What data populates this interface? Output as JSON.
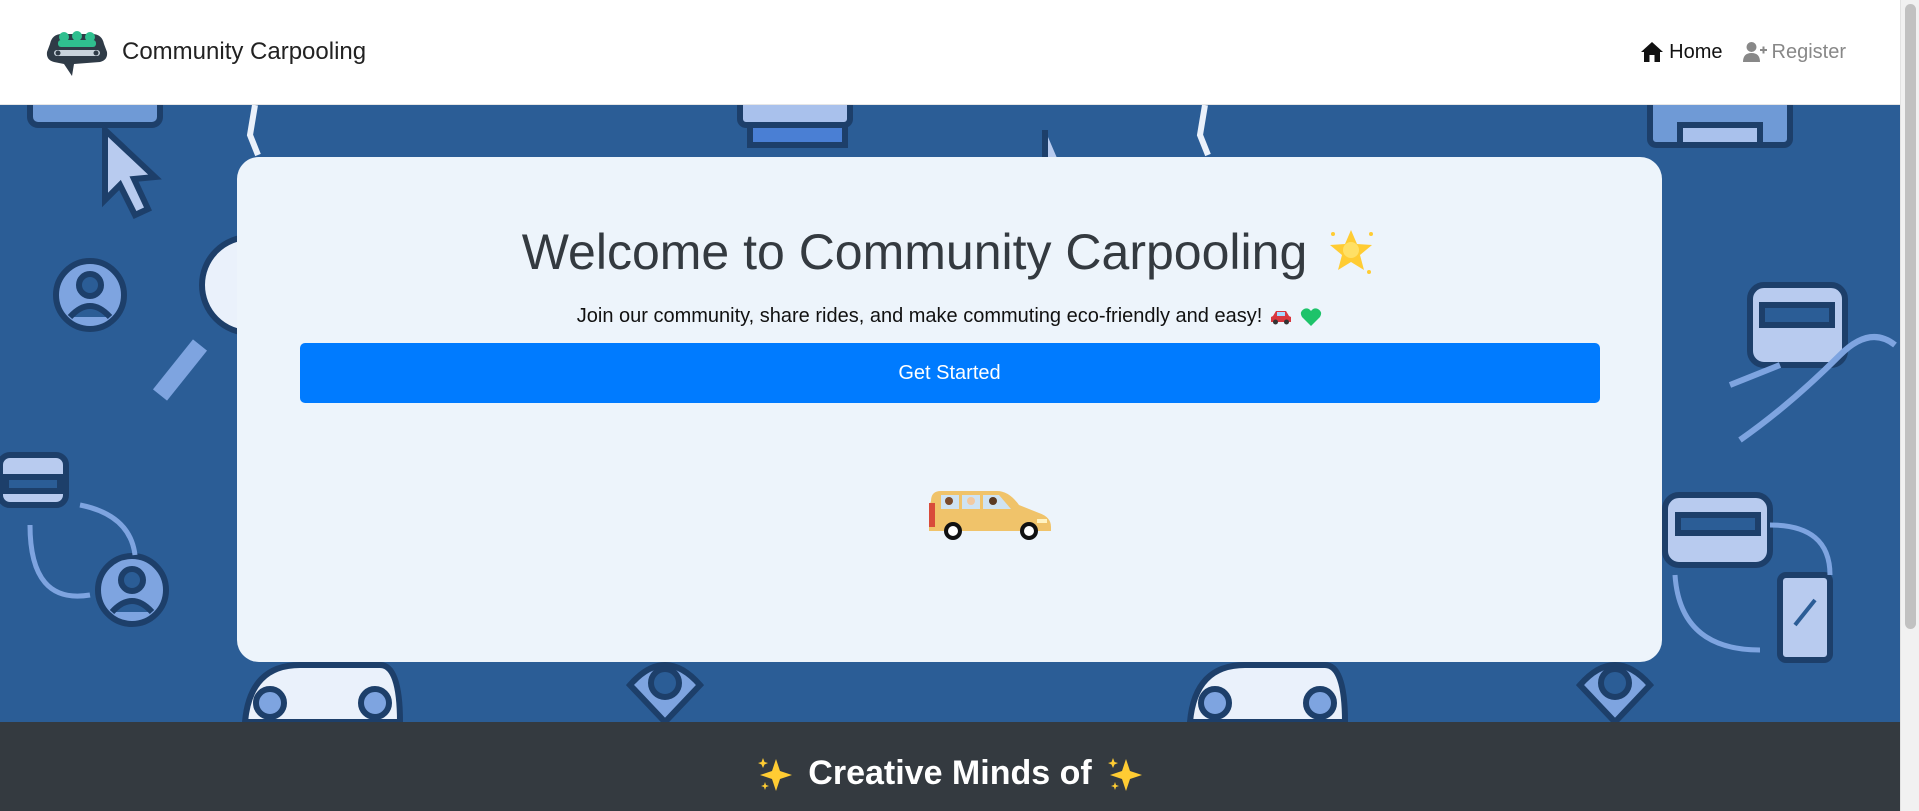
{
  "navbar": {
    "brand_text": "Community Carpooling",
    "logo_icon": "carpool-logo-icon",
    "links": [
      {
        "label": "Home",
        "icon": "home-icon",
        "active": true
      },
      {
        "label": "Register",
        "icon": "user-plus-icon",
        "active": false
      }
    ]
  },
  "hero": {
    "title": "Welcome to Community Carpooling",
    "title_icon": "glowing-star-icon",
    "subtitle": "Join our community, share rides, and make commuting eco-friendly and easy!",
    "subtitle_icons": [
      "car-emoji-icon",
      "green-heart-icon"
    ],
    "cta_label": "Get Started",
    "illustration": "van-with-passengers-illustration"
  },
  "footer": {
    "title": "Creative Minds of",
    "icons": [
      "sparkles-icon",
      "sparkles-icon"
    ]
  },
  "colors": {
    "primary": "#007bff",
    "hero_background": "#2b5d96",
    "card_background": "#edf4fb",
    "footer_background": "#343a40",
    "title_text": "#343a40"
  }
}
